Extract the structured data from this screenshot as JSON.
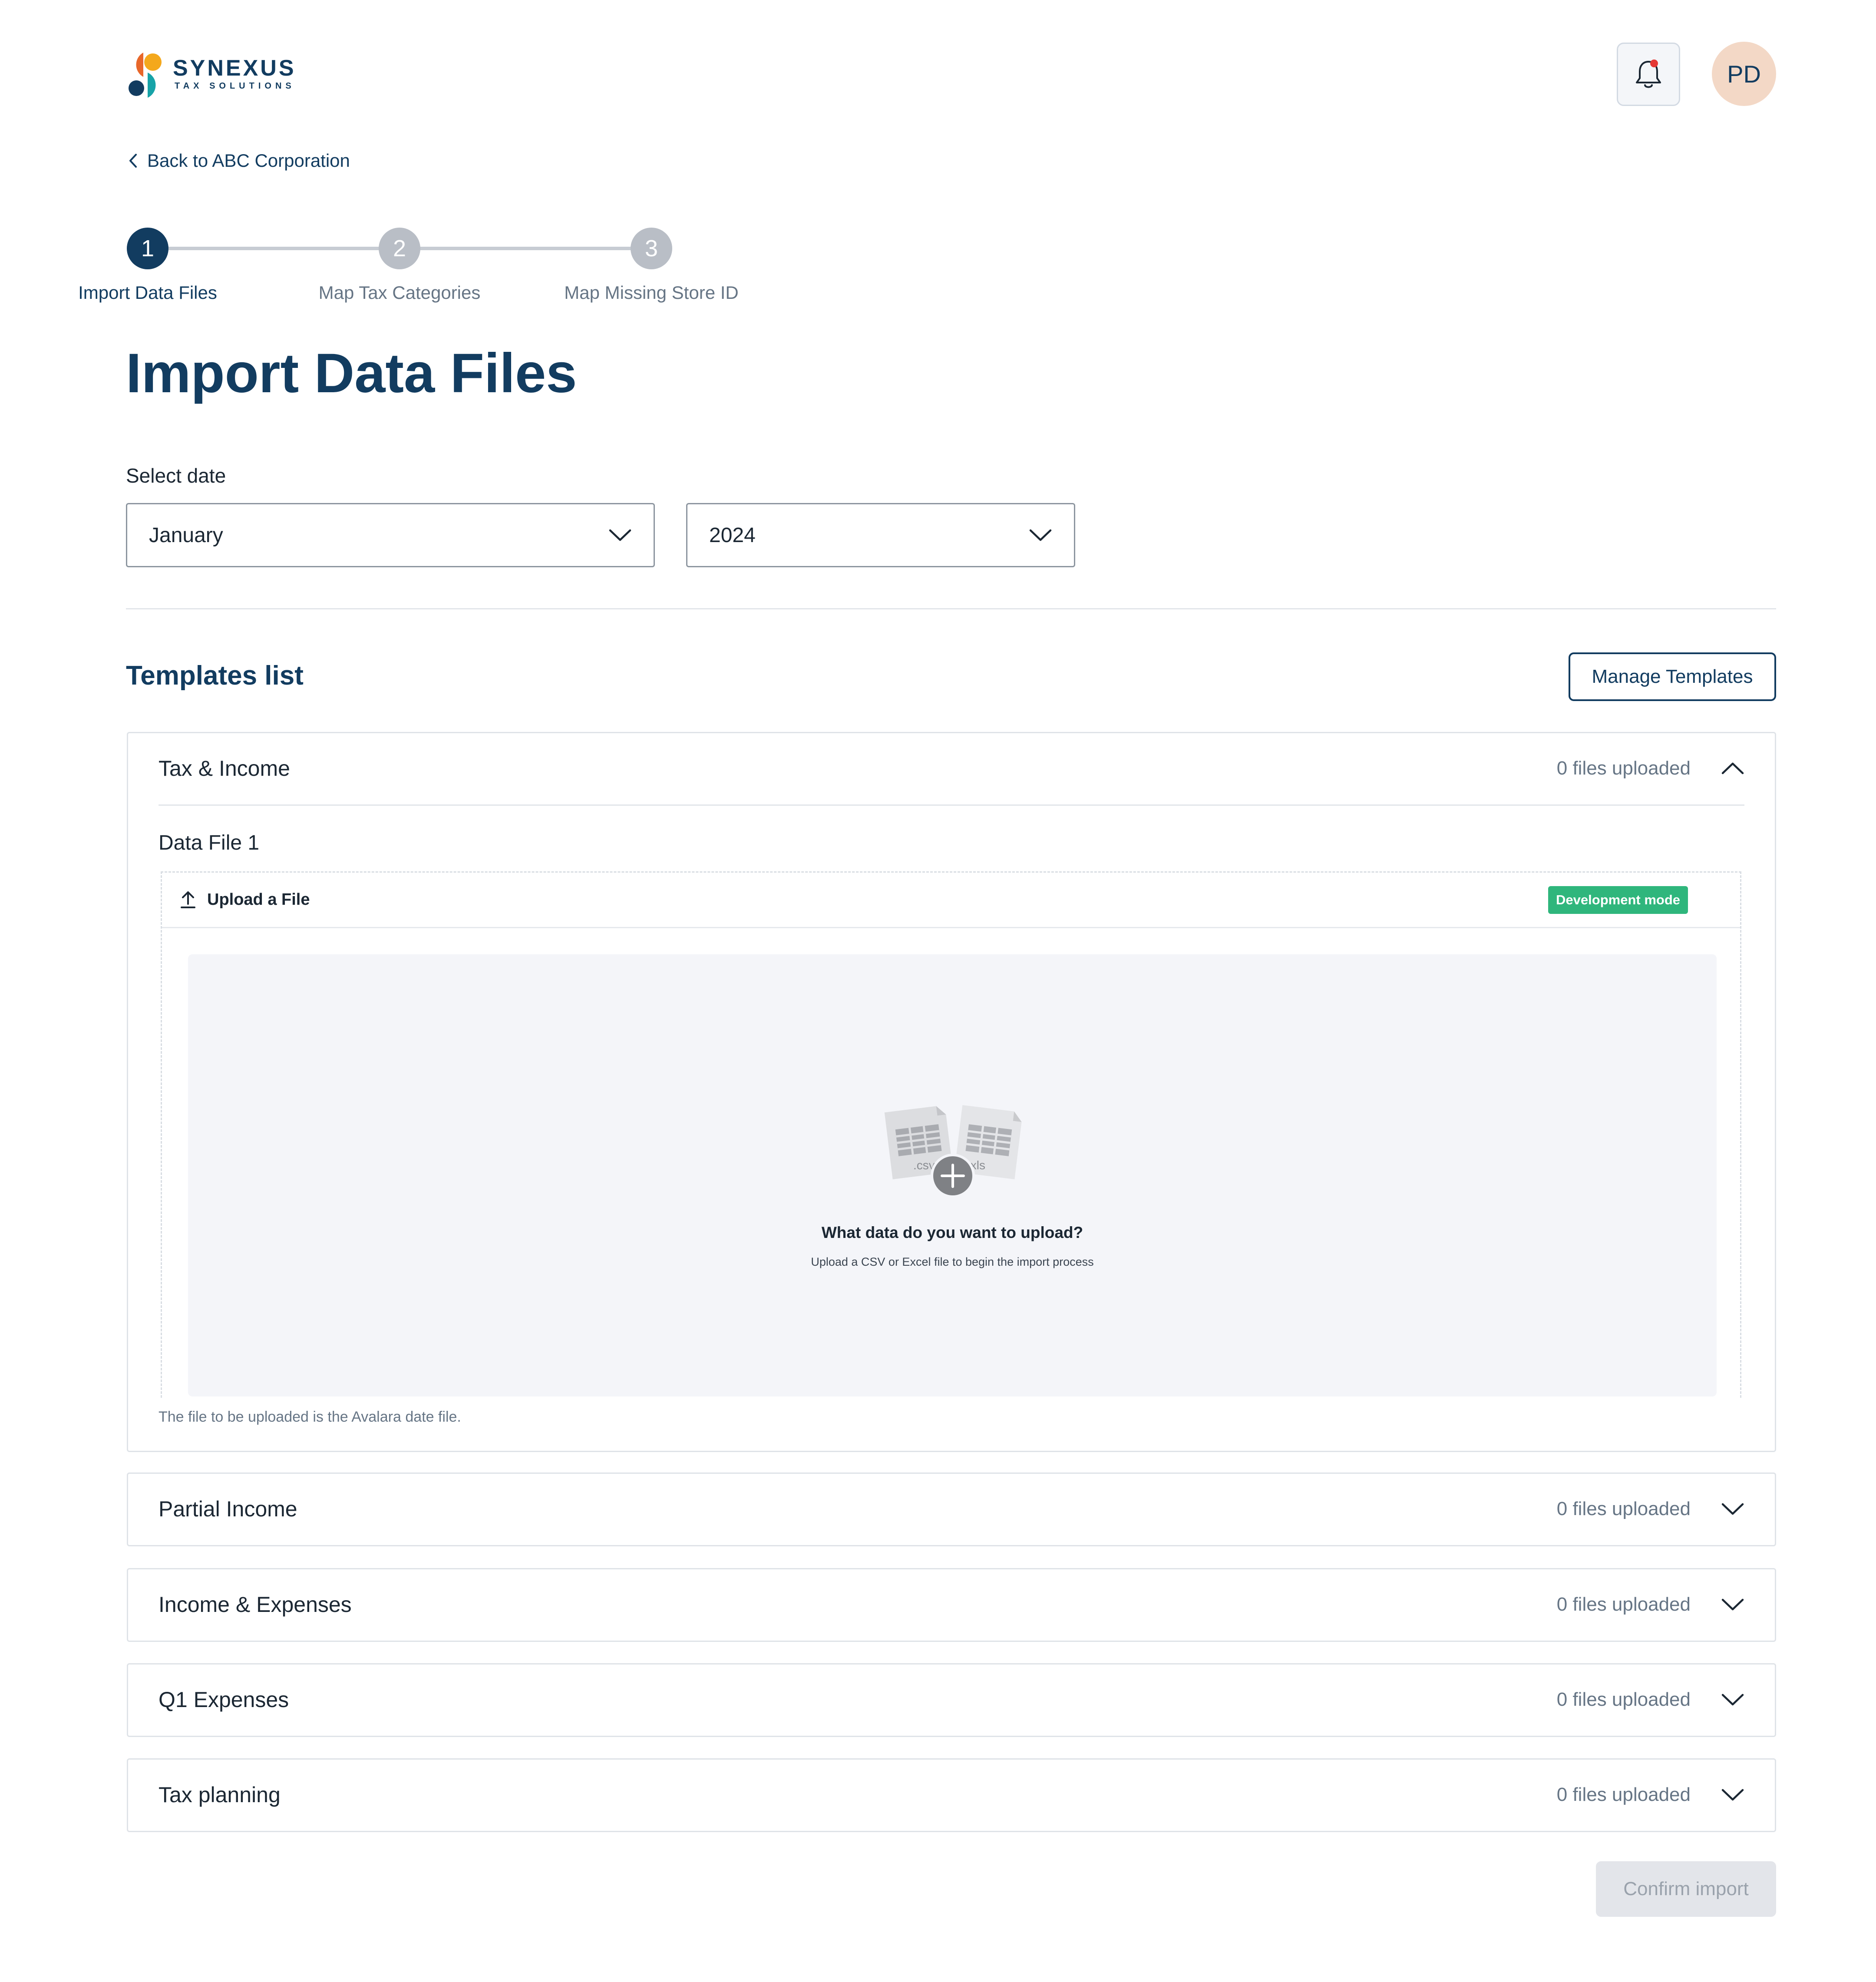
{
  "brand": {
    "name": "SYNEXUS",
    "tagline": "TAX SOLUTIONS",
    "colors": {
      "orange": "#e8672a",
      "yellow": "#f4a81c",
      "navy": "#123c60",
      "teal": "#17a3a8"
    }
  },
  "header": {
    "notification_icon": "bell-icon",
    "avatar_initials": "PD"
  },
  "breadcrumb": {
    "back_label": "Back to ABC Corporation"
  },
  "stepper": {
    "steps": [
      {
        "number": "1",
        "label": "Import Data Files",
        "state": "active"
      },
      {
        "number": "2",
        "label": "Map Tax Categories",
        "state": "inactive"
      },
      {
        "number": "3",
        "label": "Map Missing Store ID",
        "state": "inactive"
      }
    ]
  },
  "page": {
    "title": "Import Data Files"
  },
  "date_select": {
    "label": "Select date",
    "month_value": "January",
    "year_value": "2024"
  },
  "templates": {
    "title": "Templates list",
    "manage_label": "Manage Templates",
    "items": [
      {
        "title": "Tax & Income",
        "count_label": "0 files uploaded",
        "expanded": true,
        "data_file_label": "Data File 1",
        "upload_title": "Upload a File",
        "dev_badge": "Development mode",
        "file_labels": {
          "csv": ".csv",
          "xls": ".xls"
        },
        "drop_question": "What data do you want to upload?",
        "drop_sub": "Upload a CSV or Excel file to begin the import process",
        "helper": "The file to be uploaded is the Avalara date file."
      },
      {
        "title": "Partial Income",
        "count_label": "0 files uploaded",
        "expanded": false
      },
      {
        "title": "Income & Expenses",
        "count_label": "0 files uploaded",
        "expanded": false
      },
      {
        "title": "Q1 Expenses",
        "count_label": "0 files uploaded",
        "expanded": false
      },
      {
        "title": "Tax planning",
        "count_label": "0 files uploaded",
        "expanded": false
      }
    ]
  },
  "footer": {
    "confirm_label": "Confirm import",
    "confirm_state": "disabled"
  },
  "colors": {
    "primary": "#123c60",
    "success_badge": "#2fb67c",
    "disabled_bg": "#e3e5ea"
  }
}
